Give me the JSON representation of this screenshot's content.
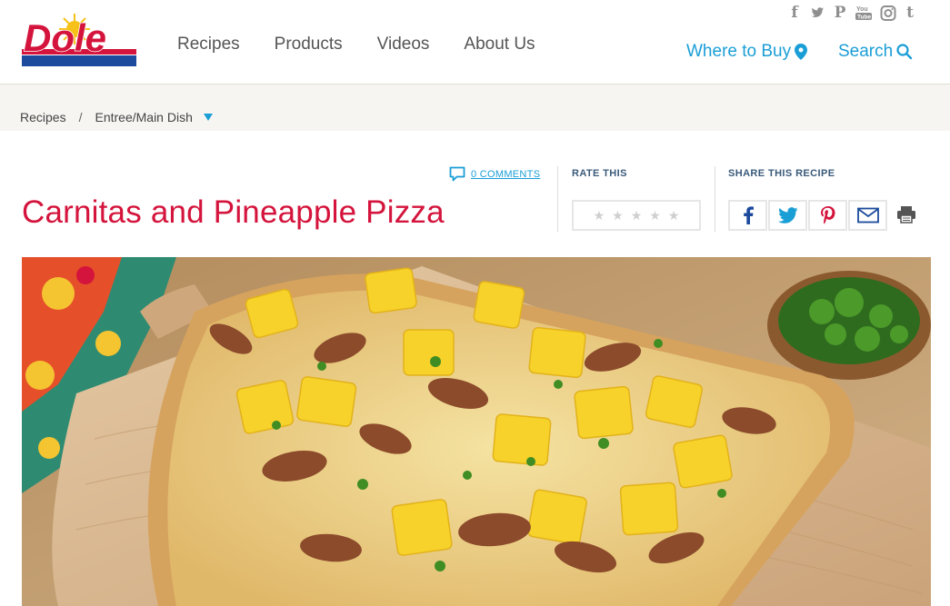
{
  "brand": {
    "logo_text": "Dole",
    "accent_color": "#d4143c",
    "link_color": "#1a9ed6"
  },
  "nav": {
    "items": [
      {
        "label": "Recipes"
      },
      {
        "label": "Products"
      },
      {
        "label": "Videos"
      },
      {
        "label": "About Us"
      }
    ]
  },
  "social": {
    "icons": [
      "facebook-icon",
      "twitter-icon",
      "pinterest-icon",
      "youtube-icon",
      "instagram-icon",
      "tumblr-icon"
    ]
  },
  "header_links": {
    "where_to_buy": "Where to Buy",
    "search": "Search"
  },
  "breadcrumb": {
    "root": "Recipes",
    "separator": "/",
    "current": "Entree/Main Dish"
  },
  "recipe": {
    "title": "Carnitas and Pineapple Pizza",
    "comments_label": "0 COMMENTS",
    "rate_label": "RATE THIS",
    "share_label": "SHARE THIS RECIPE",
    "rating": 0,
    "max_rating": 5
  }
}
